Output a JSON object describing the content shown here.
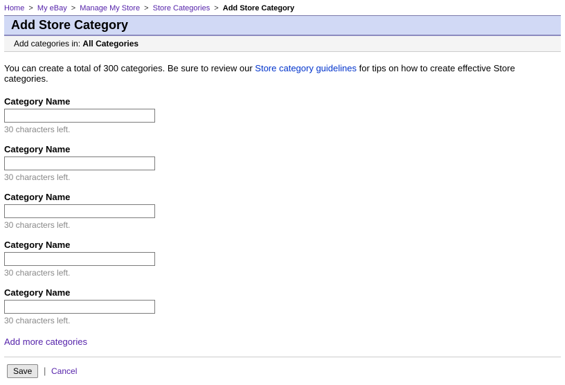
{
  "breadcrumb": {
    "items": [
      {
        "label": "Home"
      },
      {
        "label": "My eBay"
      },
      {
        "label": "Manage My Store"
      },
      {
        "label": "Store Categories"
      }
    ],
    "current": "Add Store Category",
    "sep": ">"
  },
  "title": "Add Store Category",
  "subbar": {
    "prefix": "Add categories in: ",
    "scope": "All Categories"
  },
  "intro": {
    "before": "You can create a total of 300 categories. Be sure to review our ",
    "link": "Store category guidelines",
    "after": " for tips on how to create effective Store categories."
  },
  "fields": [
    {
      "label": "Category Name",
      "value": "",
      "hint": "30 characters left."
    },
    {
      "label": "Category Name",
      "value": "",
      "hint": "30 characters left."
    },
    {
      "label": "Category Name",
      "value": "",
      "hint": "30 characters left."
    },
    {
      "label": "Category Name",
      "value": "",
      "hint": "30 characters left."
    },
    {
      "label": "Category Name",
      "value": "",
      "hint": "30 characters left."
    }
  ],
  "add_more": "Add more categories",
  "actions": {
    "save": "Save",
    "pipe": "|",
    "cancel": "Cancel"
  }
}
